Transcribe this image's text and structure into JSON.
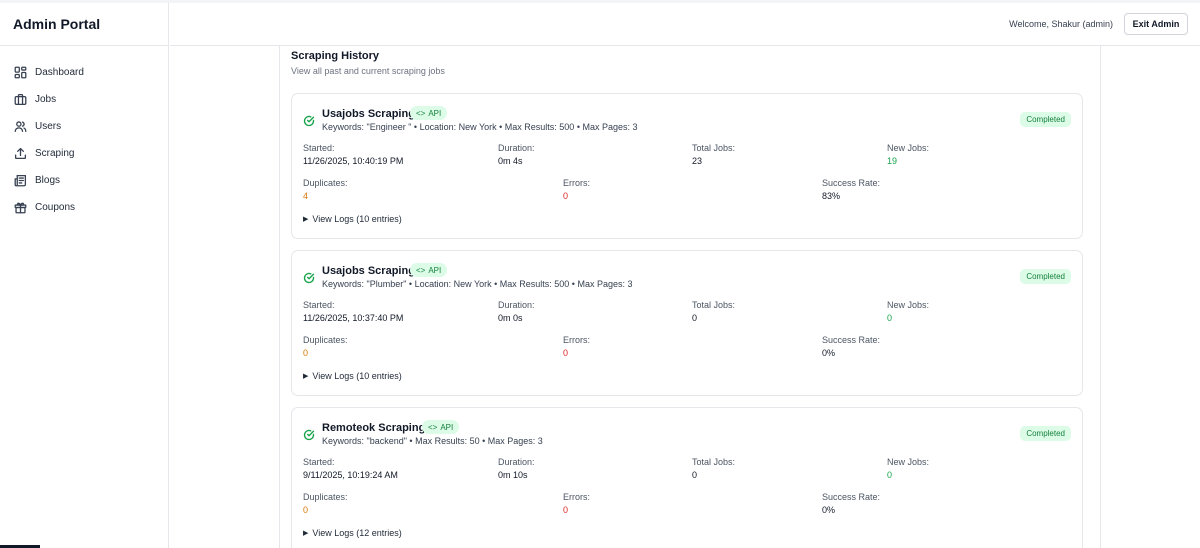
{
  "app": {
    "title": "Admin Portal"
  },
  "sidebar": {
    "items": [
      {
        "label": "Dashboard",
        "icon": "dashboard-icon"
      },
      {
        "label": "Jobs",
        "icon": "briefcase-icon"
      },
      {
        "label": "Users",
        "icon": "users-icon"
      },
      {
        "label": "Scraping",
        "icon": "upload-icon"
      },
      {
        "label": "Blogs",
        "icon": "newspaper-icon"
      },
      {
        "label": "Coupons",
        "icon": "gift-icon"
      }
    ]
  },
  "header": {
    "welcome": "Welcome, Shakur (admin)",
    "exit_label": "Exit Admin"
  },
  "main": {
    "title": "Scraping History",
    "subtitle": "View all past and current scraping jobs",
    "jobs": [
      {
        "title": "Usajobs Scraping",
        "badge": "API",
        "badge_icon": "code-icon",
        "details": "Keywords: \"Engineer \" • Location: New York • Max Results: 500 • Max Pages: 3",
        "status": "Completed",
        "started_label": "Started:",
        "started": "11/26/2025, 10:40:19 PM",
        "duration_label": "Duration:",
        "duration": "0m 4s",
        "total_label": "Total Jobs:",
        "total": "23",
        "new_label": "New Jobs:",
        "new": "19",
        "dup_label": "Duplicates:",
        "dup": "4",
        "err_label": "Errors:",
        "err": "0",
        "rate_label": "Success Rate:",
        "rate": "83%",
        "logs": "View Logs (10 entries)"
      },
      {
        "title": "Usajobs Scraping",
        "badge": "API",
        "badge_icon": "code-icon",
        "details": "Keywords: \"Plumber\" • Location: New York • Max Results: 500 • Max Pages: 3",
        "status": "Completed",
        "started_label": "Started:",
        "started": "11/26/2025, 10:37:40 PM",
        "duration_label": "Duration:",
        "duration": "0m 0s",
        "total_label": "Total Jobs:",
        "total": "0",
        "new_label": "New Jobs:",
        "new": "0",
        "dup_label": "Duplicates:",
        "dup": "0",
        "err_label": "Errors:",
        "err": "0",
        "rate_label": "Success Rate:",
        "rate": "0%",
        "logs": "View Logs (10 entries)"
      },
      {
        "title": "Remoteok Scraping",
        "badge": "API",
        "badge_icon": "code-icon",
        "details": "Keywords: \"backend\" • Max Results: 50 • Max Pages: 3",
        "status": "Completed",
        "started_label": "Started:",
        "started": "9/11/2025, 10:19:24 AM",
        "duration_label": "Duration:",
        "duration": "0m 10s",
        "total_label": "Total Jobs:",
        "total": "0",
        "new_label": "New Jobs:",
        "new": "0",
        "dup_label": "Duplicates:",
        "dup": "0",
        "err_label": "Errors:",
        "err": "0",
        "rate_label": "Success Rate:",
        "rate": "0%",
        "logs": "View Logs (12 entries)"
      }
    ]
  },
  "colors": {
    "success": "#16a34a",
    "success_bg": "#dcfce7",
    "warning": "#d97706",
    "error": "#dc2626",
    "border": "#e5e7eb"
  }
}
